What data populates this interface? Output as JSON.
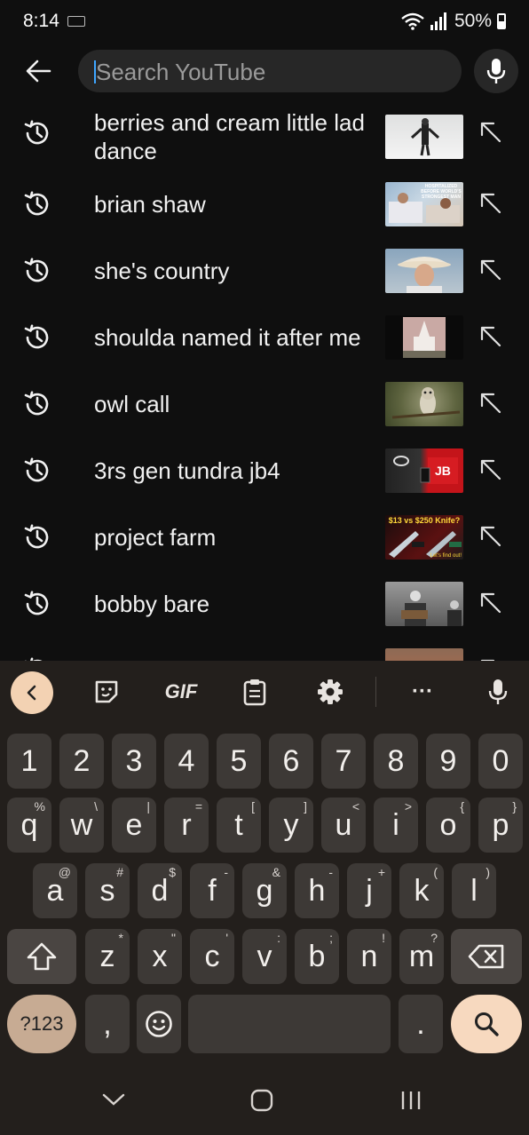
{
  "status_bar": {
    "time": "8:14",
    "battery": "50%"
  },
  "search": {
    "placeholder": "Search YouTube",
    "value": ""
  },
  "suggestions": [
    {
      "label": "berries and cream little lad dance"
    },
    {
      "label": "brian shaw"
    },
    {
      "label": "she's country"
    },
    {
      "label": "shoulda named it after me"
    },
    {
      "label": "owl call"
    },
    {
      "label": "3rs gen tundra jb4"
    },
    {
      "label": "project farm"
    },
    {
      "label": "bobby bare"
    }
  ],
  "thumb_text": {
    "brian_shaw": "HOSPITALIZED BEFORE WORLD'S STRONGEST MAN",
    "project_farm_top": "$13 vs $250 Knife?",
    "project_farm_bottom": "Let's find out!"
  },
  "keyboard": {
    "toolbar": {
      "gif": "GIF",
      "more": "···"
    },
    "number_row": [
      "1",
      "2",
      "3",
      "4",
      "5",
      "6",
      "7",
      "8",
      "9",
      "0"
    ],
    "row1": [
      {
        "k": "q",
        "h": "%"
      },
      {
        "k": "w",
        "h": "\\"
      },
      {
        "k": "e",
        "h": "|"
      },
      {
        "k": "r",
        "h": "="
      },
      {
        "k": "t",
        "h": "["
      },
      {
        "k": "y",
        "h": "]"
      },
      {
        "k": "u",
        "h": "<"
      },
      {
        "k": "i",
        "h": ">"
      },
      {
        "k": "o",
        "h": "{"
      },
      {
        "k": "p",
        "h": "}"
      }
    ],
    "row2": [
      {
        "k": "a",
        "h": "@"
      },
      {
        "k": "s",
        "h": "#"
      },
      {
        "k": "d",
        "h": "$"
      },
      {
        "k": "f",
        "h": "-"
      },
      {
        "k": "g",
        "h": "&"
      },
      {
        "k": "h",
        "h": "-"
      },
      {
        "k": "j",
        "h": "+"
      },
      {
        "k": "k",
        "h": "("
      },
      {
        "k": "l",
        "h": ")"
      }
    ],
    "row3": [
      {
        "k": "z",
        "h": "*"
      },
      {
        "k": "x",
        "h": "\""
      },
      {
        "k": "c",
        "h": "'"
      },
      {
        "k": "v",
        "h": ":"
      },
      {
        "k": "b",
        "h": ";"
      },
      {
        "k": "n",
        "h": "!"
      },
      {
        "k": "m",
        "h": "?"
      }
    ],
    "symbols_label": "?123",
    "comma": ",",
    "period": "."
  },
  "colors": {
    "background": "#0f0f0f",
    "search_box": "#272727",
    "keyboard_bg": "#231f1c",
    "key": "#3d3936",
    "accent_peach": "#f7d9bf",
    "accent_tan": "#c7ab93"
  }
}
